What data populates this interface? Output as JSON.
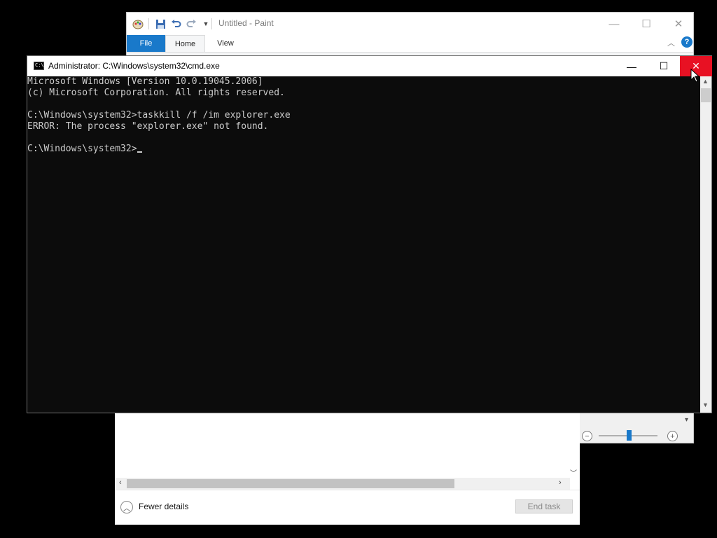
{
  "paint": {
    "title": "Untitled - Paint",
    "tabs": {
      "file": "File",
      "home": "Home",
      "view": "View"
    },
    "qat": {
      "save_icon": "save-icon",
      "undo_icon": "undo-icon",
      "redo_icon": "redo-icon",
      "customize_icon": "chevron-down-icon"
    },
    "controls": {
      "minimize": "—",
      "maximize": "☐",
      "close": "✕"
    },
    "help": "?",
    "zoom_out": "−",
    "zoom_in": "+",
    "accent_color": "#1979ca"
  },
  "task_manager": {
    "fewer_details": "Fewer details",
    "end_task": "End task"
  },
  "cmd": {
    "title": "Administrator: C:\\Windows\\system32\\cmd.exe",
    "icon_text": "C:\\",
    "controls": {
      "minimize": "—",
      "maximize": "☐",
      "close": "✕"
    },
    "close_color": "#e81123",
    "lines": [
      "Microsoft Windows [Version 10.0.19045.2006]",
      "(c) Microsoft Corporation. All rights reserved.",
      "",
      "C:\\Windows\\system32>taskkill /f /im explorer.exe",
      "ERROR: The process \"explorer.exe\" not found.",
      "",
      "C:\\Windows\\system32>"
    ]
  }
}
